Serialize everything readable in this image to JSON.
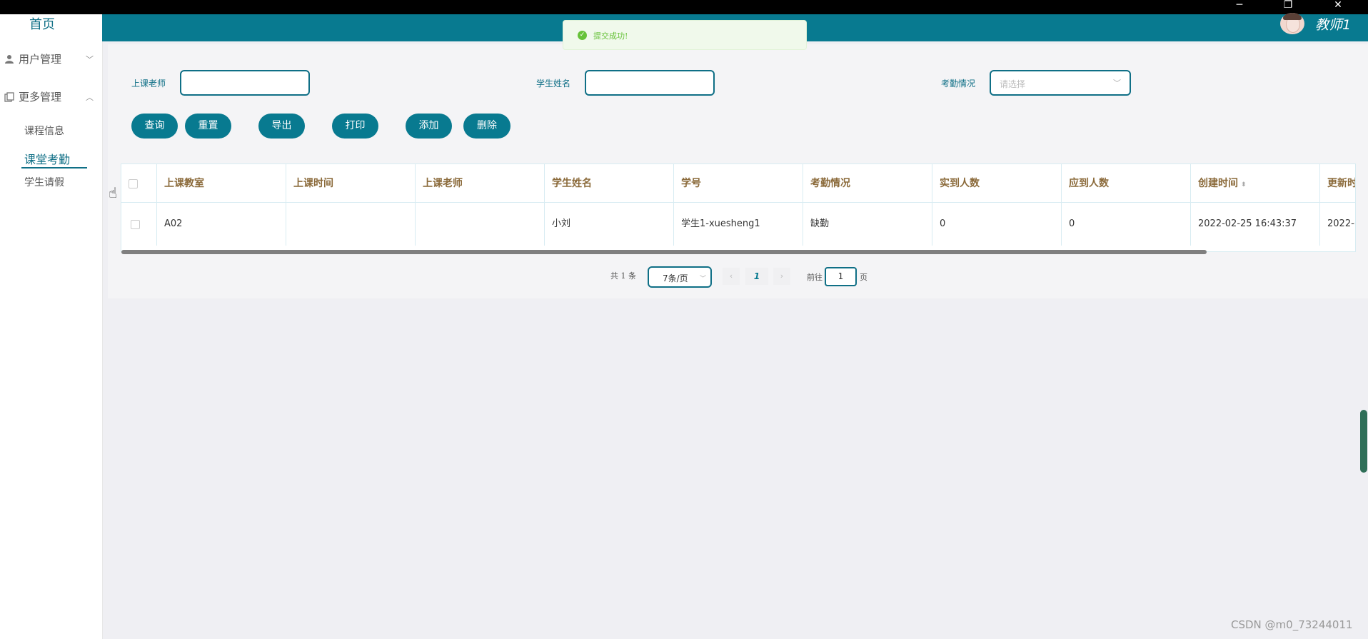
{
  "window": {
    "minimize_icon": "minimize-icon",
    "restore_icon": "restore-icon",
    "close_icon": "close-icon"
  },
  "sidebar": {
    "home": "首页",
    "menus": [
      {
        "label": "用户管理",
        "icon": "user-icon",
        "chevron": "﹀"
      },
      {
        "label": "更多管理",
        "icon": "copy-icon",
        "chevron": "︿"
      }
    ],
    "items": [
      {
        "label": "课程信息"
      },
      {
        "label": "课堂考勤"
      },
      {
        "label": "学生请假"
      }
    ]
  },
  "header": {
    "username": "教师1",
    "bg_color": "#087a90"
  },
  "toast": {
    "message": "提交成功!"
  },
  "search": {
    "teacher_label": "上课老师",
    "student_label": "学生姓名",
    "attendance_label": "考勤情况",
    "attendance_placeholder": "请选择"
  },
  "buttons": {
    "query": "查询",
    "reset": "重置",
    "export": "导出",
    "print": "打印",
    "add": "添加",
    "delete": "删除"
  },
  "table": {
    "headers": [
      "上课教室",
      "上课时间",
      "上课老师",
      "学生姓名",
      "学号",
      "考勤情况",
      "实到人数",
      "应到人数",
      "创建时间",
      "更新时"
    ],
    "rows": [
      [
        "A02",
        "",
        "",
        "小刘",
        "学生1-xuesheng1",
        "缺勤",
        "0",
        "0",
        "2022-02-25 16:43:37",
        "2022-("
      ]
    ]
  },
  "pagination": {
    "total": "共 1 条",
    "page_size": "7条/页",
    "current_page": "1",
    "goto_prefix": "前往",
    "goto_value": "1",
    "goto_suffix": "页",
    "prev": "‹",
    "next": "›"
  },
  "watermark": "CSDN @m0_73244011",
  "colors": {
    "accent": "#087a90",
    "success": "#67c23a"
  }
}
